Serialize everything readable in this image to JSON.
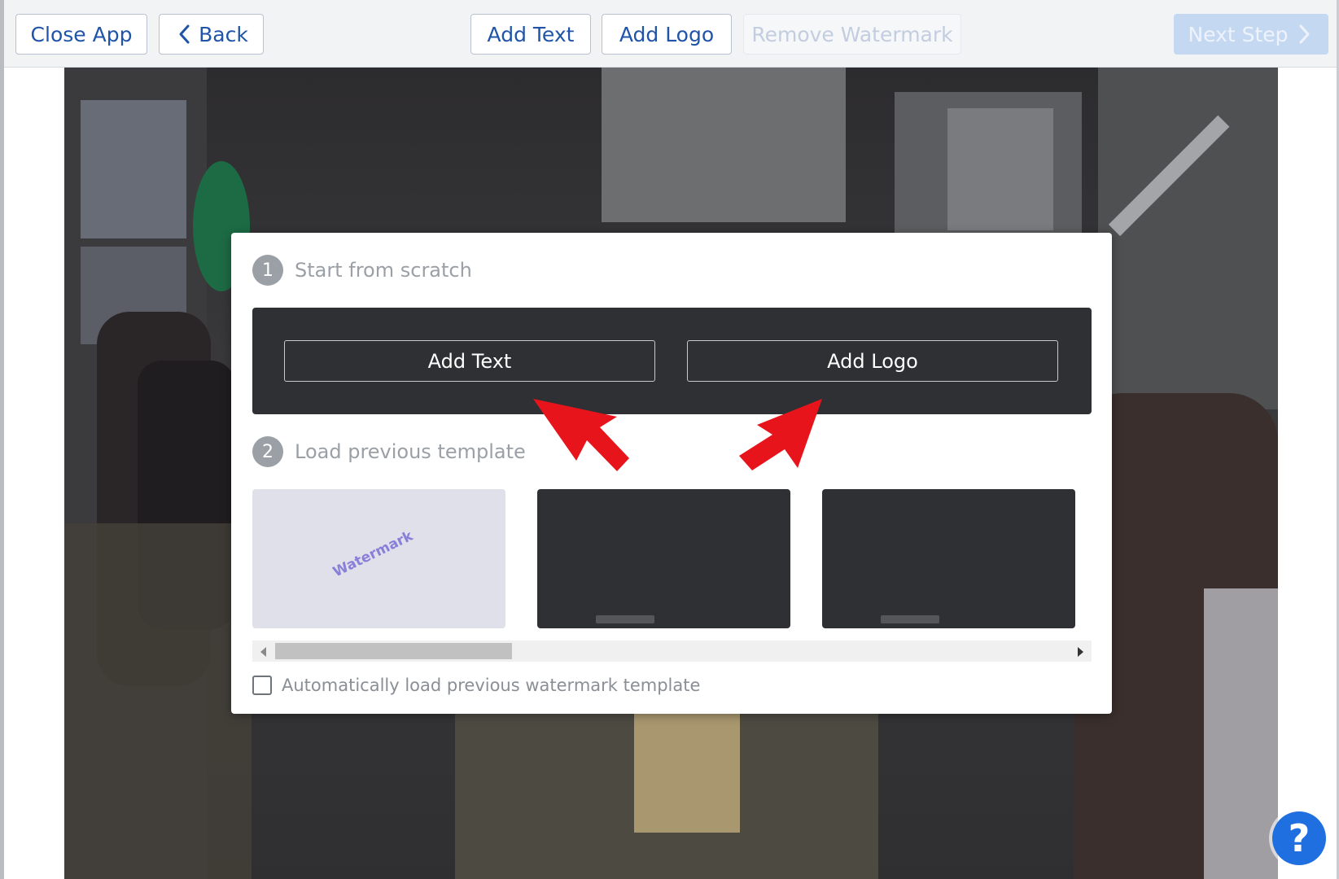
{
  "toolbar": {
    "close_app": "Close App",
    "back": "Back",
    "add_text": "Add Text",
    "add_logo": "Add Logo",
    "remove_watermark": "Remove Watermark",
    "next_step": "Next Step"
  },
  "modal": {
    "step1": {
      "number": "1",
      "label": "Start from scratch"
    },
    "scratch_buttons": {
      "add_text": "Add Text",
      "add_logo": "Add Logo"
    },
    "step2": {
      "number": "2",
      "label": "Load previous template"
    },
    "templates": [
      {
        "preview_text": "Watermark",
        "style": "light"
      },
      {
        "preview_text": "",
        "style": "dark"
      },
      {
        "preview_text": "",
        "style": "dark"
      }
    ],
    "auto_load_label": "Automatically load previous watermark template"
  },
  "help": {
    "label": "?"
  },
  "colors": {
    "accent": "#1f54a8",
    "annotation_arrow": "#e8141c",
    "help_button": "#1f6fe0"
  }
}
